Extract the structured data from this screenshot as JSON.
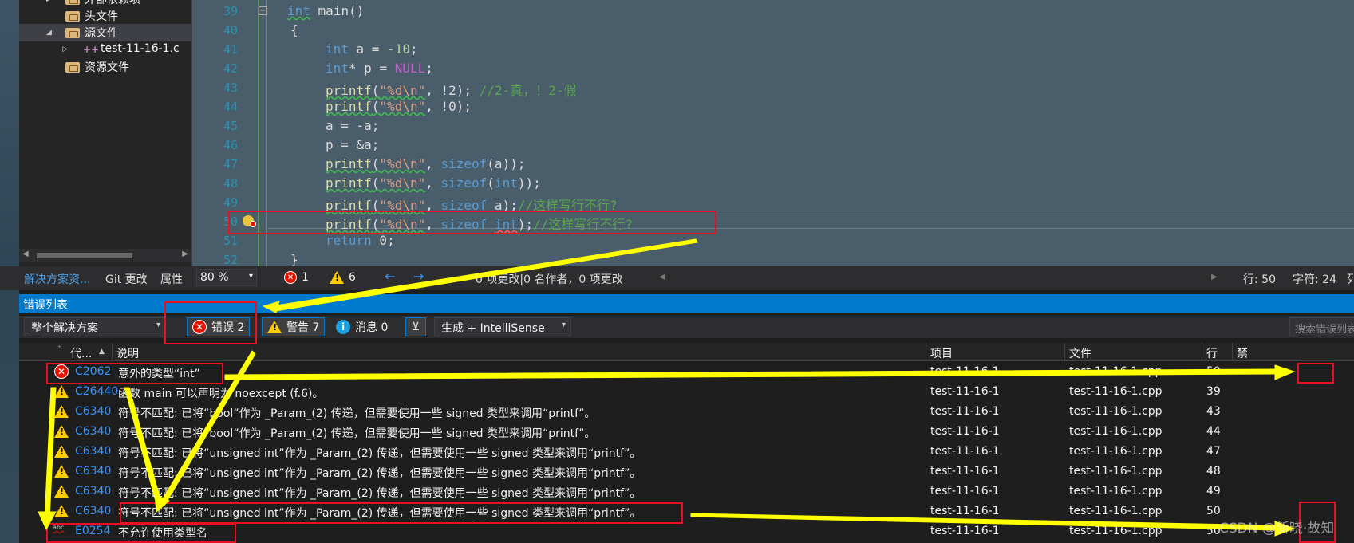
{
  "solution_explorer": {
    "items": [
      {
        "label": "外部依赖项"
      },
      {
        "label": "头文件"
      },
      {
        "label": "源文件"
      },
      {
        "label": "test-11-16-1.c"
      },
      {
        "label": "资源文件"
      }
    ],
    "tabs": [
      "解决方案资...",
      "Git 更改",
      "属性"
    ]
  },
  "editor": {
    "lines": [
      {
        "n": "39"
      },
      {
        "n": "40"
      },
      {
        "n": "41"
      },
      {
        "n": "42"
      },
      {
        "n": "43"
      },
      {
        "n": "44"
      },
      {
        "n": "45"
      },
      {
        "n": "46"
      },
      {
        "n": "47"
      },
      {
        "n": "48"
      },
      {
        "n": "49"
      },
      {
        "n": "50"
      },
      {
        "n": "51"
      },
      {
        "n": "52"
      }
    ],
    "code": {
      "l39_kw": "int",
      "l39_rest": " main()",
      "l40": "{",
      "l41_kw": "int",
      "l41_rest": " a = ",
      "l41_num": "-10",
      "l41_end": ";",
      "l42_kw": "int",
      "l42_rest": "* p = ",
      "l42_mac": "NULL",
      "l42_end": ";",
      "l43_fn": "printf",
      "l43_a": "(",
      "l43_str": "\"%d\\n\"",
      "l43_b": ", !2); ",
      "l43_cm": "//2-真，！2-假",
      "l44_fn": "printf",
      "l44_a": "(",
      "l44_str": "\"%d\\n\"",
      "l44_b": ", !0);",
      "l45": "a = -a;",
      "l46": "p = &a;",
      "l47_fn": "printf",
      "l47_a": "(",
      "l47_str": "\"%d\\n\"",
      "l47_b": ", ",
      "l47_kw": "sizeof",
      "l47_c": "(a));",
      "l48_fn": "printf",
      "l48_a": "(",
      "l48_str": "\"%d\\n\"",
      "l48_b": ", ",
      "l48_kw": "sizeof",
      "l48_c": "(",
      "l48_kw2": "int",
      "l48_d": "));",
      "l49_fn": "printf",
      "l49_a": "(",
      "l49_str": "\"%d\\n\"",
      "l49_b": ", ",
      "l49_kw": "sizeof",
      "l49_c": " a);",
      "l49_cm": "//这样写行不行?",
      "l50_fn": "printf",
      "l50_a": "(",
      "l50_str": "\"%d\\n\"",
      "l50_b": ", ",
      "l50_kw": "sizeof",
      "l50_sp": " ",
      "l50_kw2": "int",
      "l50_c": ");",
      "l50_cm": "//这样写行不行?",
      "l51_kw": "return",
      "l51_rest": " 0;",
      "l52": "}"
    }
  },
  "statusbar": {
    "zoom": "80 %",
    "errors": "1",
    "warnings": "6",
    "changes": "0 项更改|0 名作者，0 项更改",
    "line": "行: 50",
    "char": "字符: 24",
    "trailing": "列"
  },
  "error_list": {
    "title": "错误列表",
    "scope": "整个解决方案",
    "errors_btn": "错误 2",
    "warnings_btn": "警告 7",
    "messages_btn": "消息 0",
    "build_filter": "生成 + IntelliSense",
    "search_placeholder": "搜索错误列表",
    "columns": {
      "code": "代...",
      "desc": "说明",
      "project": "项目",
      "file": "文件",
      "line": "行",
      "suppress": "禁"
    },
    "rows": [
      {
        "type": "error",
        "code": "C2062",
        "desc": "意外的类型“int”",
        "project": "test-11-16-1",
        "file": "test-11-16-1.cpp",
        "line": "50"
      },
      {
        "type": "warning",
        "code": "C26440",
        "desc": "函数 main 可以声明为 noexcept (f.6)。",
        "project": "test-11-16-1",
        "file": "test-11-16-1.cpp",
        "line": "39"
      },
      {
        "type": "warning",
        "code": "C6340",
        "desc": "符号不匹配: 已将“bool”作为 _Param_(2) 传递，但需要使用一些 signed 类型来调用“printf”。",
        "project": "test-11-16-1",
        "file": "test-11-16-1.cpp",
        "line": "43"
      },
      {
        "type": "warning",
        "code": "C6340",
        "desc": "符号不匹配: 已将“bool”作为 _Param_(2) 传递，但需要使用一些 signed 类型来调用“printf”。",
        "project": "test-11-16-1",
        "file": "test-11-16-1.cpp",
        "line": "44"
      },
      {
        "type": "warning",
        "code": "C6340",
        "desc": "符号不匹配: 已将“unsigned int”作为 _Param_(2) 传递，但需要使用一些 signed 类型来调用“printf”。",
        "project": "test-11-16-1",
        "file": "test-11-16-1.cpp",
        "line": "47"
      },
      {
        "type": "warning",
        "code": "C6340",
        "desc": "符号不匹配: 已将“unsigned int”作为 _Param_(2) 传递，但需要使用一些 signed 类型来调用“printf”。",
        "project": "test-11-16-1",
        "file": "test-11-16-1.cpp",
        "line": "48"
      },
      {
        "type": "warning",
        "code": "C6340",
        "desc": "符号不匹配: 已将“unsigned int”作为 _Param_(2) 传递，但需要使用一些 signed 类型来调用“printf”。",
        "project": "test-11-16-1",
        "file": "test-11-16-1.cpp",
        "line": "49"
      },
      {
        "type": "warning",
        "code": "C6340",
        "desc": "符号不匹配: 已将“unsigned int”作为 _Param_(2) 传递，但需要使用一些 signed 类型来调用“printf”。",
        "project": "test-11-16-1",
        "file": "test-11-16-1.cpp",
        "line": "50"
      },
      {
        "type": "intellisense",
        "code": "E0254",
        "desc": "不允许使用类型名",
        "project": "test-11-16-1",
        "file": "test-11-16-1.cpp",
        "line": "50"
      }
    ]
  },
  "watermark": "CSDN @新晓·故知",
  "colors": {
    "accent": "#007acc",
    "error": "#e51400",
    "warning": "#ffcc00",
    "annotation_red": "#e81123",
    "annotation_arrow": "#ffff00"
  }
}
